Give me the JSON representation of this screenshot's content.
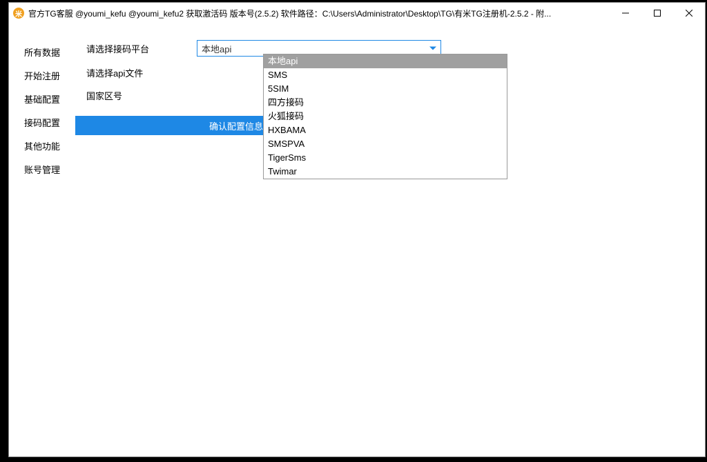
{
  "window": {
    "title": "官方TG客服 @youmi_kefu @youmi_kefu2 获取激活码 版本号(2.5.2) 软件路径：C:\\Users\\Administrator\\Desktop\\TG\\有米TG注册机-2.5.2  - 附..."
  },
  "sidebar": {
    "items": [
      {
        "label": "所有数据"
      },
      {
        "label": "开始注册"
      },
      {
        "label": "基础配置"
      },
      {
        "label": "接码配置"
      },
      {
        "label": "其他功能"
      },
      {
        "label": "账号管理"
      }
    ]
  },
  "form": {
    "platform_label": "请选择接码平台",
    "platform_value": "本地api",
    "api_file_label": "请选择api文件",
    "country_code_label": "国家区号",
    "confirm_button": "确认配置信息"
  },
  "dropdown": {
    "options": [
      {
        "label": "本地api",
        "selected": true
      },
      {
        "label": "SMS",
        "selected": false
      },
      {
        "label": "5SIM",
        "selected": false
      },
      {
        "label": "四方接码",
        "selected": false
      },
      {
        "label": "火狐接码",
        "selected": false
      },
      {
        "label": "HXBAMA",
        "selected": false
      },
      {
        "label": "SMSPVA",
        "selected": false
      },
      {
        "label": "TigerSms",
        "selected": false
      },
      {
        "label": "Twimar",
        "selected": false
      }
    ]
  }
}
